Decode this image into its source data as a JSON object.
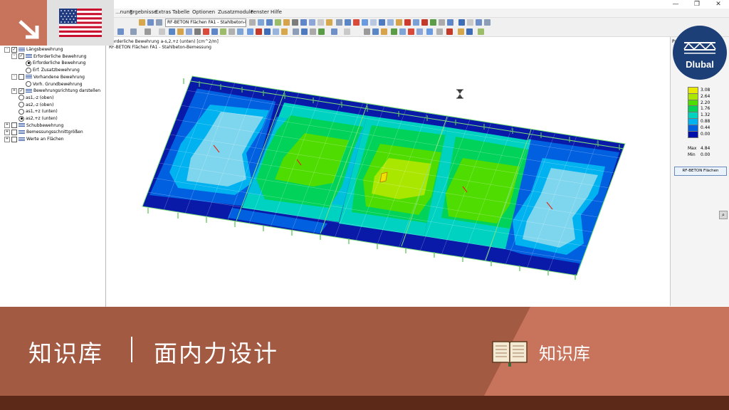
{
  "menu": {
    "items": [
      "...nung",
      "Ergebnisse",
      "Extras",
      "Tabelle",
      "Optionen",
      "Zusatzmodule",
      "Fenster",
      "Hilfe"
    ]
  },
  "toolbar": {
    "module_combo": "RF-BETON Flächen FA1 - Stahlbeton-Be"
  },
  "navigator": {
    "items": [
      {
        "label": "Längsbewehrung",
        "level": 0,
        "expander": "-",
        "control": "checkbox",
        "checked": true
      },
      {
        "label": "Erforderliche Bewehrung",
        "level": 1,
        "expander": "-",
        "control": "checkbox",
        "checked": true
      },
      {
        "label": "Erforderliche Bewehrung",
        "level": 2,
        "expander": "",
        "control": "radio",
        "checked": true
      },
      {
        "label": "Erf. Zusatzbewehrung",
        "level": 2,
        "expander": "",
        "control": "radio",
        "checked": false
      },
      {
        "label": "Vorhandene Bewehrung",
        "level": 1,
        "expander": "-",
        "control": "checkbox",
        "checked": false
      },
      {
        "label": "Vorh. Grundbewehrung",
        "level": 2,
        "expander": "",
        "control": "radio",
        "checked": false
      },
      {
        "label": "Bewehrungsrichtung darstellen",
        "level": 1,
        "expander": "+",
        "control": "checkbox",
        "checked": true
      },
      {
        "label": "as1,-z (oben)",
        "level": 1,
        "expander": "",
        "control": "radio",
        "checked": false
      },
      {
        "label": "as2,-z (oben)",
        "level": 1,
        "expander": "",
        "control": "radio",
        "checked": false
      },
      {
        "label": "as1,+z (unten)",
        "level": 1,
        "expander": "",
        "control": "radio",
        "checked": false
      },
      {
        "label": "as2,+z (unten)",
        "level": 1,
        "expander": "",
        "control": "radio",
        "checked": true
      },
      {
        "label": "Schubbewehrung",
        "level": 0,
        "expander": "+",
        "control": "checkbox",
        "checked": false
      },
      {
        "label": "Bemessungsschnittgrößen",
        "level": 0,
        "expander": "+",
        "control": "checkbox",
        "checked": false
      },
      {
        "label": "Werte an Flächen",
        "level": 0,
        "expander": "+",
        "control": "checkbox",
        "checked": false
      }
    ]
  },
  "workarea": {
    "info_line1": "rforderliche Bewehrung a-s,2,+z (unten) [cm^2/m]",
    "info_line2": "RF-BETON Flächen FA1 - Stahlbeton-Bemessung"
  },
  "legend": {
    "header": "Pa",
    "rows": [
      {
        "value": "3.08",
        "color": "#e8e800"
      },
      {
        "value": "2.64",
        "color": "#a9e600"
      },
      {
        "value": "2.20",
        "color": "#4fdc00"
      },
      {
        "value": "1.76",
        "color": "#00d25a"
      },
      {
        "value": "1.32",
        "color": "#00d2c2"
      },
      {
        "value": "0.88",
        "color": "#00b2f0"
      },
      {
        "value": "0.44",
        "color": "#0060e0"
      },
      {
        "value": "0.00",
        "color": "#0010a8"
      }
    ],
    "max_label": "Max",
    "max_value": "4.84",
    "min_label": "Min",
    "min_value": "0.00",
    "button": "RF-BETON Flächen"
  },
  "logo": {
    "name": "Dlubal"
  },
  "banner": {
    "title": "知识库",
    "subtitle": "面内力设计",
    "kb_label": "知识库"
  },
  "icons": [
    "arrow-down-right-icon",
    "us-flag-icon",
    "book-icon",
    "hourglass-icon",
    "zoom-icon"
  ],
  "colors": {
    "banner": "#a35a42",
    "banner_light": "#c8745d",
    "banner_dark": "#5c2818",
    "logo": "#1d3f78"
  }
}
